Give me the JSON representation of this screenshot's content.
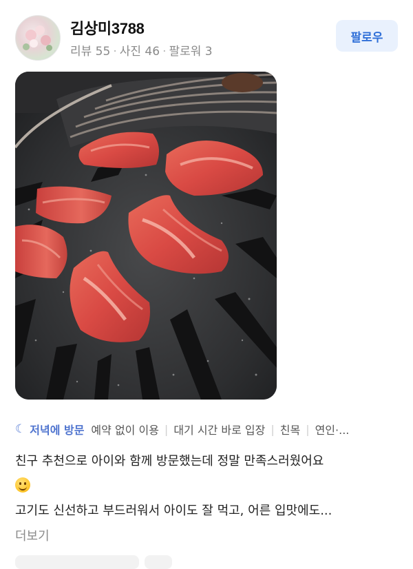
{
  "profile": {
    "username": "김상미3788",
    "stats": [
      "리뷰 55",
      "사진 46",
      "팔로워 3"
    ],
    "follow_label": "팔로우"
  },
  "tags": {
    "visit_icon": "moon-icon",
    "visit_label": "저녁에 방문",
    "items": [
      "예약 없이 이용",
      "대기 시간 바로 입장",
      "친목",
      "연인·..."
    ]
  },
  "review": {
    "line1": "친구 추천으로 아이와 함께 방문했는데 정말 만족스러웠어요",
    "emoji": "smiling-face-emoji",
    "line2": "고기도 신선하고 부드러워서 아이도 잘 먹고, 어른 입맛에도...",
    "more_label": "더보기"
  },
  "colors": {
    "accent": "#2f6fd8",
    "follow_bg": "#e9f1fd",
    "visit": "#4f74cf"
  }
}
